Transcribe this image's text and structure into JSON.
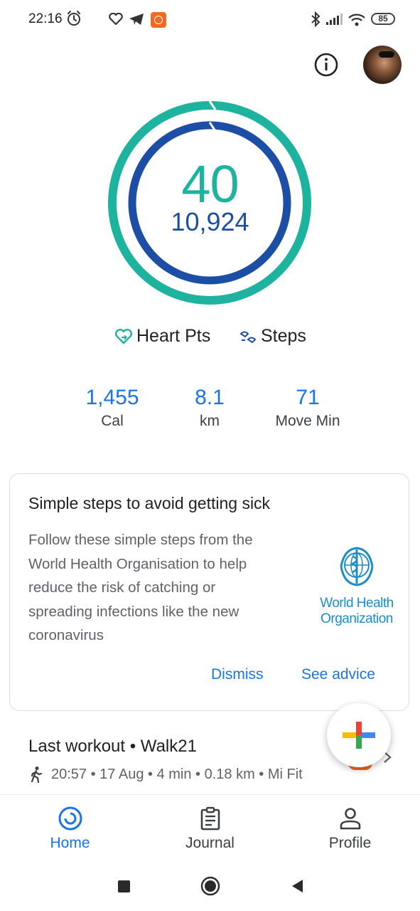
{
  "status_bar": {
    "time": "22:16",
    "battery": "85"
  },
  "summary": {
    "heart_points": "40",
    "steps": "10,924",
    "goal_color": "#1db39e",
    "steps_color": "#1d4ea6"
  },
  "legend": {
    "heart_label": "Heart Pts",
    "steps_label": "Steps"
  },
  "stats": [
    {
      "value": "1,455",
      "label": "Cal"
    },
    {
      "value": "8.1",
      "label": "km"
    },
    {
      "value": "71",
      "label": "Move Min"
    }
  ],
  "card": {
    "title": "Simple steps to avoid getting sick",
    "body": "Follow these simple steps from the World Health Organisation to help reduce the risk of catching or spreading infections like the new coronavirus",
    "logo_line1": "World Health",
    "logo_line2": "Organization",
    "dismiss": "Dismiss",
    "see_advice": "See advice"
  },
  "workout": {
    "title": "Last workout • Walk21",
    "meta": "20:57 • 17 Aug • 4 min • 0.18 km • Mi Fit"
  },
  "nav": {
    "home": "Home",
    "journal": "Journal",
    "profile": "Profile"
  },
  "colors": {
    "accent": "#1a73e8",
    "orange": "#f26a21"
  },
  "icons": [
    "alarm-icon",
    "heart-outline-icon",
    "telegram-icon",
    "mi-app-icon",
    "bluetooth-icon",
    "signal-icon",
    "wifi-icon",
    "info-icon",
    "plus-icon",
    "walk-icon",
    "chevron-right-icon",
    "home-icon",
    "journal-icon",
    "profile-icon",
    "recents-icon",
    "home-button-icon",
    "back-icon"
  ]
}
